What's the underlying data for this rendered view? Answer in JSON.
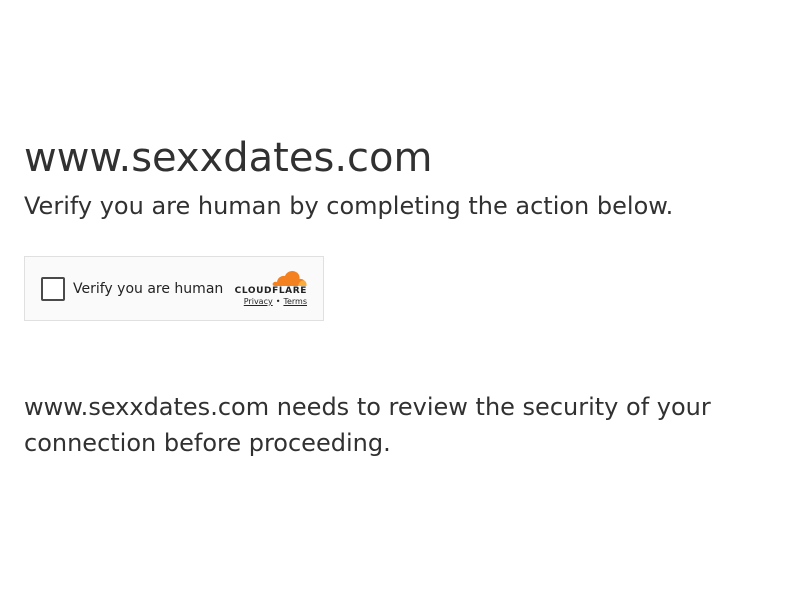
{
  "page": {
    "domain": "www.sexxdates.com",
    "subtitle": "Verify you are human by completing the action below.",
    "notice": "www.sexxdates.com needs to review the security of your connection before proceeding."
  },
  "challenge": {
    "checkbox_label": "Verify you are human",
    "checkbox_checked": false,
    "brand": "CLOUDFLARE",
    "privacy_link": "Privacy",
    "separator": "•",
    "terms_link": "Terms"
  },
  "colors": {
    "text": "#313131",
    "widget_bg": "#fafafa",
    "widget_border": "#e0e0e0",
    "cloud_orange": "#f48120",
    "cloud_light": "#faad3f"
  },
  "icons": {
    "brand_logo": "cloudflare-cloud-icon"
  }
}
